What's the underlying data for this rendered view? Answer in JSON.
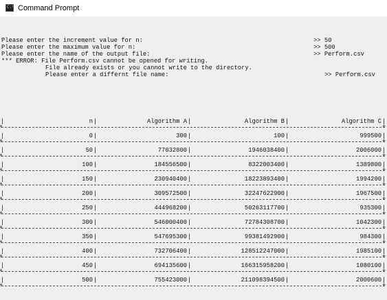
{
  "window": {
    "title": "Command Prompt",
    "icon": "command-prompt-icon",
    "icon_text": "C:\\"
  },
  "prompts": [
    {
      "text": "Please enter the increment value for n:",
      "answer": ">> 50"
    },
    {
      "text": "Please enter the maximum value for n:",
      "answer": ">> 500"
    },
    {
      "text": "Please enter the name of the output file:",
      "answer": ">> Perform.csv"
    }
  ],
  "error": {
    "line1": "*** ERROR: File Perform.csv cannot be opened for writing.",
    "line2": "File already exists or you cannot write to the directory.",
    "line3": "Please enter a differnt file name:",
    "answer": ">> Perform.csv"
  },
  "table": {
    "headers": [
      "n",
      "Algorithm A",
      "Algorithm B",
      "Algorithm C"
    ],
    "rows": [
      [
        "0",
        "300",
        "100",
        "999500"
      ],
      [
        "50",
        "77032800",
        "1946038400",
        "2006000"
      ],
      [
        "100",
        "184556500",
        "8322003400",
        "1389800"
      ],
      [
        "150",
        "230940400",
        "18223893400",
        "1994200"
      ],
      [
        "200",
        "309572500",
        "32247622900",
        "1967500"
      ],
      [
        "250",
        "444968200",
        "50263117700",
        "935300"
      ],
      [
        "300",
        "546000400",
        "72784308700",
        "1042300"
      ],
      [
        "350",
        "547695300",
        "99381492900",
        "984300"
      ],
      [
        "400",
        "732706400",
        "128512247000",
        "1985100"
      ],
      [
        "450",
        "694135600",
        "166315958200",
        "1080100"
      ],
      [
        "500",
        "755423000",
        "211098394500",
        "2000600"
      ]
    ]
  }
}
